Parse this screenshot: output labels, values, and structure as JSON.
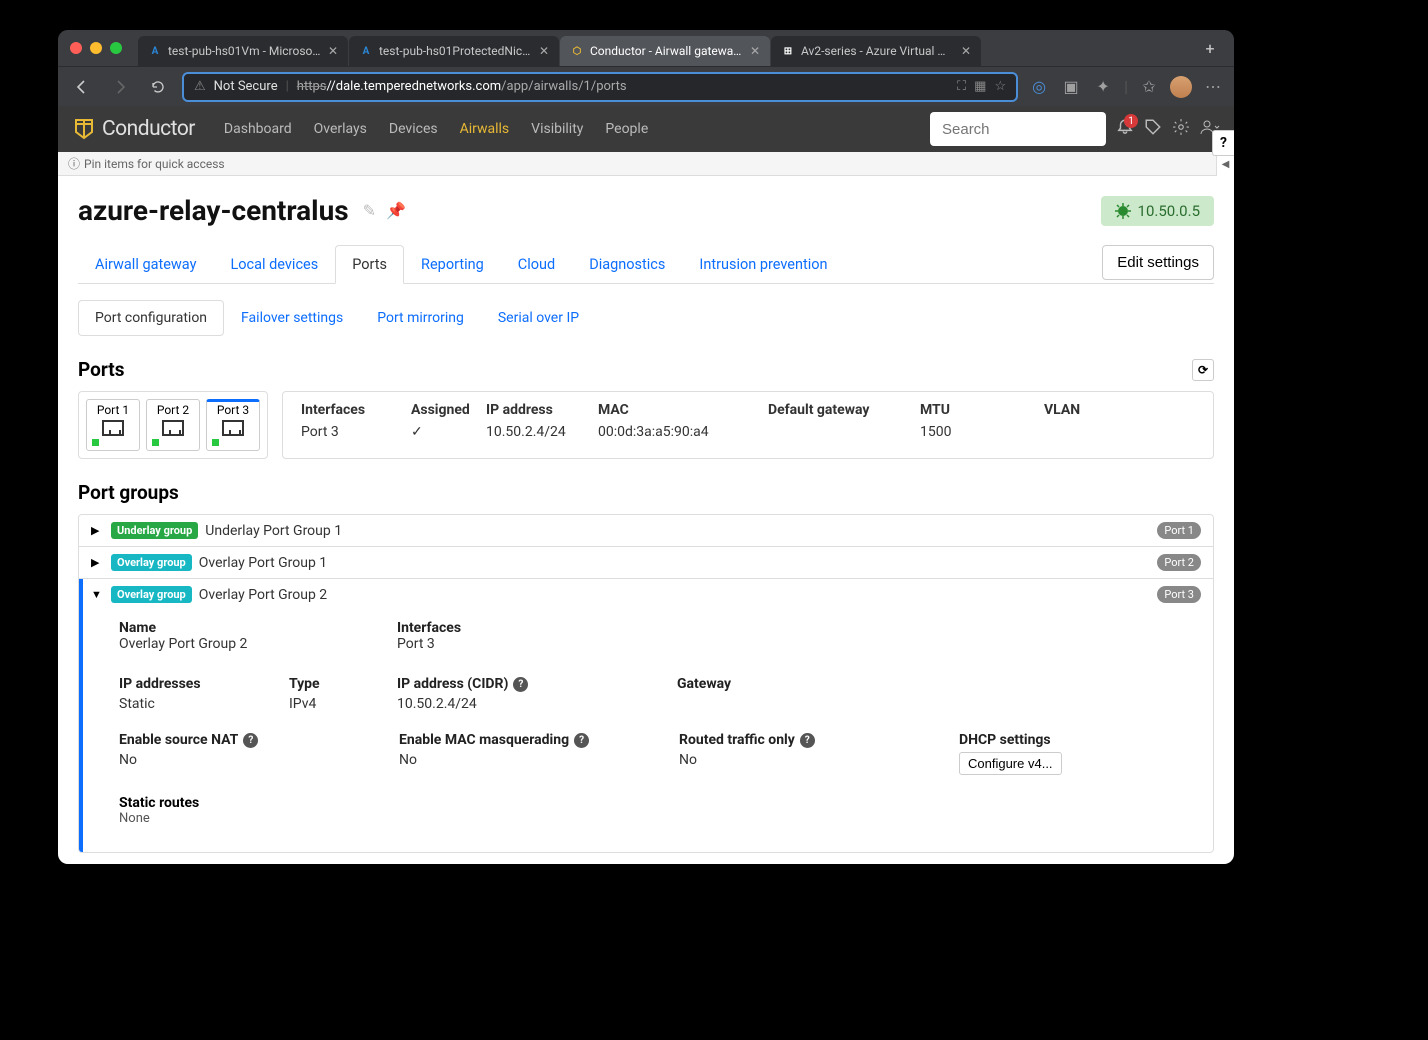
{
  "browser_tabs": [
    {
      "title": "test-pub-hs01Vm - Microsoft A",
      "fav_color": "#2b88d8",
      "fav_text": "A"
    },
    {
      "title": "test-pub-hs01ProtectedNic - M",
      "fav_color": "#2b88d8",
      "fav_text": "A"
    },
    {
      "title": "Conductor - Airwall gateway - ",
      "fav_color": "#e8b935",
      "fav_text": "⬡",
      "active": true
    },
    {
      "title": "Av2-series - Azure Virtual Mac",
      "fav_color": "#fff",
      "fav_text": "⊞"
    }
  ],
  "url_not_secure": "Not Secure",
  "url_https": "https",
  "url_host": "//dale.temperednetworks.com",
  "url_path": "/app/airwalls/1/ports",
  "brand": "Conductor",
  "nav": [
    "Dashboard",
    "Overlays",
    "Devices",
    "Airwalls",
    "Visibility",
    "People"
  ],
  "nav_active": "Airwalls",
  "search_placeholder": "Search",
  "bell_badge": "1",
  "pin_text": "Pin items for quick access",
  "page_title": "azure-relay-centralus",
  "ip_badge": "10.50.0.5",
  "main_tabs": [
    "Airwall gateway",
    "Local devices",
    "Ports",
    "Reporting",
    "Cloud",
    "Diagnostics",
    "Intrusion prevention"
  ],
  "main_tab_active": "Ports",
  "edit_settings": "Edit settings",
  "sub_tabs": [
    "Port configuration",
    "Failover settings",
    "Port mirroring",
    "Serial over IP"
  ],
  "sub_tab_active": "Port configuration",
  "ports_heading": "Ports",
  "port_cards": [
    "Port 1",
    "Port 2",
    "Port 3"
  ],
  "port_selected": "Port 3",
  "if_headers": {
    "int": "Interfaces",
    "asg": "Assigned",
    "ip": "IP address",
    "mac": "MAC",
    "gw": "Default gateway",
    "mtu": "MTU",
    "vlan": "VLAN"
  },
  "if_row": {
    "int": "Port 3",
    "asg": "✓",
    "ip": "10.50.2.4/24",
    "mac": "00:0d:3a:a5:90:a4",
    "gw": "",
    "mtu": "1500",
    "vlan": ""
  },
  "pg_heading": "Port groups",
  "pg_underlay_badge": "Underlay group",
  "pg_overlay_badge": "Overlay group",
  "pg_rows": [
    {
      "badge": "Underlay group",
      "badge_cls": "bg-ug",
      "name": "Underlay Port Group 1",
      "port": "Port 1",
      "expanded": false
    },
    {
      "badge": "Overlay group",
      "badge_cls": "bg-og",
      "name": "Overlay Port Group 1",
      "port": "Port 2",
      "expanded": false
    },
    {
      "badge": "Overlay group",
      "badge_cls": "bg-og",
      "name": "Overlay Port Group 2",
      "port": "Port 3",
      "expanded": true
    }
  ],
  "det": {
    "name_lbl": "Name",
    "name_val": "Overlay Port Group 2",
    "int_lbl": "Interfaces",
    "int_val": "Port 3",
    "ipa_lbl": "IP addresses",
    "static": "Static",
    "type_lbl": "Type",
    "type_val": "IPv4",
    "ipc_lbl": "IP address (CIDR)",
    "ipc_val": "10.50.2.4/24",
    "gw_lbl": "Gateway",
    "gw_val": "",
    "nat_lbl": "Enable source NAT",
    "no": "No",
    "mac_lbl": "Enable MAC masquerading",
    "rt_lbl": "Routed traffic only",
    "dhcp_lbl": "DHCP settings",
    "dhcp_btn": "Configure v4...",
    "sr_lbl": "Static routes",
    "sr_val": "None"
  }
}
